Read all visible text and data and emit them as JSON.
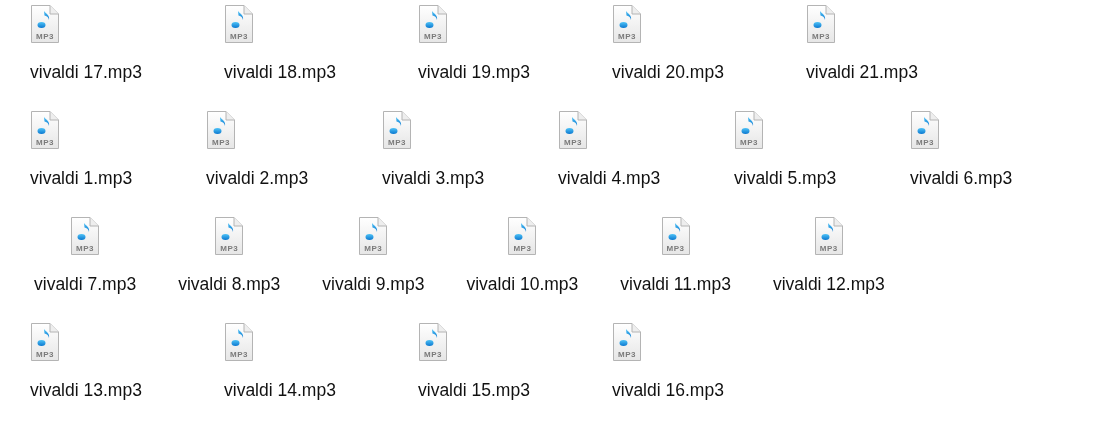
{
  "rows": [
    {
      "files": [
        {
          "name": "vivaldi 17.mp3",
          "type": "MP3"
        },
        {
          "name": "vivaldi 18.mp3",
          "type": "MP3"
        },
        {
          "name": "vivaldi 19.mp3",
          "type": "MP3"
        },
        {
          "name": "vivaldi 20.mp3",
          "type": "MP3"
        },
        {
          "name": "vivaldi 21.mp3",
          "type": "MP3"
        }
      ]
    },
    {
      "files": [
        {
          "name": "vivaldi 1.mp3",
          "type": "MP3"
        },
        {
          "name": "vivaldi 2.mp3",
          "type": "MP3"
        },
        {
          "name": "vivaldi 3.mp3",
          "type": "MP3"
        },
        {
          "name": "vivaldi 4.mp3",
          "type": "MP3"
        },
        {
          "name": "vivaldi 5.mp3",
          "type": "MP3"
        },
        {
          "name": "vivaldi 6.mp3",
          "type": "MP3"
        }
      ]
    },
    {
      "files": [
        {
          "name": "vivaldi 7.mp3",
          "type": "MP3"
        },
        {
          "name": "vivaldi 8.mp3",
          "type": "MP3"
        },
        {
          "name": "vivaldi 9.mp3",
          "type": "MP3"
        },
        {
          "name": "vivaldi 10.mp3",
          "type": "MP3"
        },
        {
          "name": "vivaldi 11.mp3",
          "type": "MP3"
        },
        {
          "name": "vivaldi 12.mp3",
          "type": "MP3"
        }
      ]
    },
    {
      "files": [
        {
          "name": "vivaldi 13.mp3",
          "type": "MP3"
        },
        {
          "name": "vivaldi 14.mp3",
          "type": "MP3"
        },
        {
          "name": "vivaldi 15.mp3",
          "type": "MP3"
        },
        {
          "name": "vivaldi 16.mp3",
          "type": "MP3"
        }
      ]
    }
  ]
}
